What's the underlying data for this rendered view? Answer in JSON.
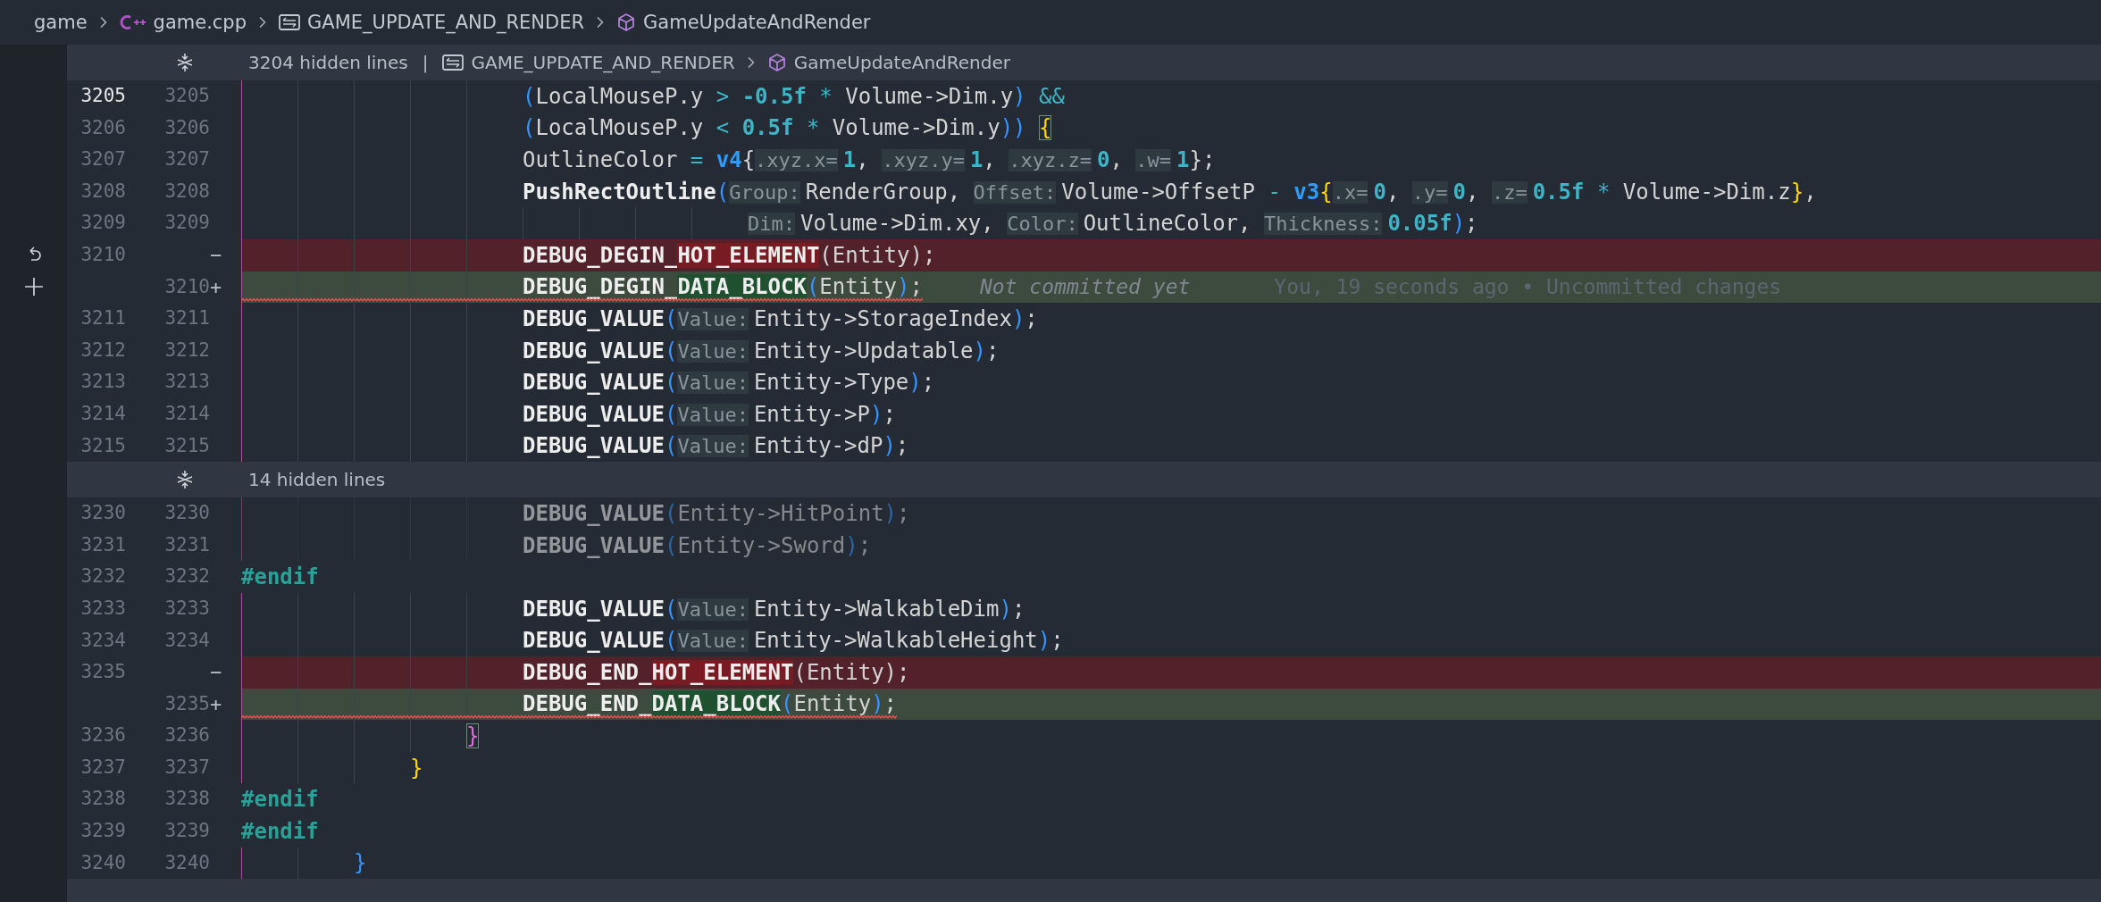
{
  "breadcrumbs": [
    {
      "kind": "folder",
      "text": "game"
    },
    {
      "kind": "cpp",
      "text": "game.cpp"
    },
    {
      "kind": "macro",
      "text": "GAME_UPDATE_AND_RENDER"
    },
    {
      "kind": "function",
      "text": "GameUpdateAndRender"
    }
  ],
  "blocks": [
    {
      "kind": "fold",
      "text": "3204 hidden lines",
      "separator": "|",
      "breadcrumbs": [
        {
          "kind": "macro",
          "text": "GAME_UPDATE_AND_RENDER"
        },
        {
          "kind": "function",
          "text": "GameUpdateAndRender"
        }
      ]
    },
    {
      "kind": "lines",
      "rows": [
        {
          "old": "3205",
          "new": "3205",
          "kind": "context",
          "current": true,
          "indent": "\t\t\t\t\t",
          "tokens": [
            {
              "kind": "paren",
              "text": "("
            },
            {
              "kind": "text",
              "text": "LocalMouseP.y "
            },
            {
              "kind": "op",
              "text": "> "
            },
            {
              "kind": "num",
              "text": "-0.5f "
            },
            {
              "kind": "op",
              "text": "* "
            },
            {
              "kind": "text",
              "text": "Volume->Dim.y"
            },
            {
              "kind": "paren",
              "text": ")"
            },
            {
              "kind": "op",
              "text": " &&"
            }
          ]
        },
        {
          "old": "3206",
          "new": "3206",
          "kind": "context",
          "indent": "\t\t\t\t\t",
          "tokens": [
            {
              "kind": "paren",
              "text": "("
            },
            {
              "kind": "text",
              "text": "LocalMouseP.y "
            },
            {
              "kind": "op",
              "text": "< "
            },
            {
              "kind": "num",
              "text": "0.5f "
            },
            {
              "kind": "op",
              "text": "* "
            },
            {
              "kind": "text",
              "text": "Volume->Dim.y"
            },
            {
              "kind": "paren",
              "text": ")) "
            },
            {
              "kind": "brace",
              "text": "{",
              "color": "#ffd700",
              "matched": true
            }
          ]
        },
        {
          "old": "3207",
          "new": "3207",
          "kind": "context",
          "indent": "\t\t\t\t\t",
          "tokens": [
            {
              "kind": "text",
              "text": "OutlineColor "
            },
            {
              "kind": "op",
              "text": "= "
            },
            {
              "kind": "type",
              "text": "v4"
            },
            {
              "kind": "text",
              "text": "{"
            },
            {
              "kind": "hint",
              "text": ".xyz.x="
            },
            {
              "kind": "num",
              "text": "1"
            },
            {
              "kind": "text",
              "text": ", "
            },
            {
              "kind": "hint",
              "text": ".xyz.y="
            },
            {
              "kind": "num",
              "text": "1"
            },
            {
              "kind": "text",
              "text": ", "
            },
            {
              "kind": "hint",
              "text": ".xyz.z="
            },
            {
              "kind": "num",
              "text": "0"
            },
            {
              "kind": "text",
              "text": ", "
            },
            {
              "kind": "hint",
              "text": ".w="
            },
            {
              "kind": "num",
              "text": "1"
            },
            {
              "kind": "text",
              "text": "};"
            }
          ]
        },
        {
          "old": "3208",
          "new": "3208",
          "kind": "context",
          "indent": "\t\t\t\t\t",
          "tokens": [
            {
              "kind": "fn",
              "text": "PushRectOutline"
            },
            {
              "kind": "paren",
              "text": "("
            },
            {
              "kind": "hint",
              "text": "Group:"
            },
            {
              "kind": "text",
              "text": "RenderGroup, "
            },
            {
              "kind": "hint",
              "text": "Offset:"
            },
            {
              "kind": "text",
              "text": "Volume->OffsetP "
            },
            {
              "kind": "op",
              "text": "- "
            },
            {
              "kind": "type",
              "text": "v3"
            },
            {
              "kind": "brace",
              "text": "{",
              "color": "#ffd700",
              "matched": false
            },
            {
              "kind": "hint",
              "text": ".x="
            },
            {
              "kind": "num",
              "text": "0"
            },
            {
              "kind": "text",
              "text": ", "
            },
            {
              "kind": "hint",
              "text": ".y="
            },
            {
              "kind": "num",
              "text": "0"
            },
            {
              "kind": "text",
              "text": ", "
            },
            {
              "kind": "hint",
              "text": ".z="
            },
            {
              "kind": "num",
              "text": "0.5f "
            },
            {
              "kind": "op",
              "text": "* "
            },
            {
              "kind": "text",
              "text": "Volume->Dim.z"
            },
            {
              "kind": "brace",
              "text": "}",
              "color": "#ffd700",
              "matched": false
            },
            {
              "kind": "text",
              "text": ","
            }
          ]
        },
        {
          "old": "3209",
          "new": "3209",
          "kind": "context",
          "indent": "\t\t\t\t\t\t\t\t\t",
          "tokens": [
            {
              "kind": "hint",
              "text": "Dim:"
            },
            {
              "kind": "text",
              "text": "Volume->Dim.xy, "
            },
            {
              "kind": "hint",
              "text": "Color:"
            },
            {
              "kind": "text",
              "text": "OutlineColor, "
            },
            {
              "kind": "hint",
              "text": "Thickness:"
            },
            {
              "kind": "num",
              "text": "0.05f"
            },
            {
              "kind": "paren",
              "text": ")"
            },
            {
              "kind": "text",
              "text": ";"
            }
          ]
        },
        {
          "old": "3210",
          "marker": "−",
          "kind": "removed",
          "actions": true,
          "indent": "\t\t\t\t\t",
          "tokens": [
            {
              "kind": "fn",
              "text": "DEBUG_DEGIN_"
            },
            {
              "kind": "fn",
              "text": "HOT_ELEMENT",
              "changed": true
            },
            {
              "kind": "text",
              "text": "(Entity);"
            }
          ]
        },
        {
          "new": "3210",
          "marker": "+",
          "kind": "added",
          "actions": true,
          "error": true,
          "indent": "\t\t\t\t\t",
          "tokens": [
            {
              "kind": "fn",
              "text": "DEBUG_DEGIN_"
            },
            {
              "kind": "fn",
              "text": "DATA_BLOCK",
              "changed": true
            },
            {
              "kind": "paren",
              "text": "("
            },
            {
              "kind": "text",
              "text": "Entity"
            },
            {
              "kind": "paren",
              "text": ")"
            },
            {
              "kind": "text",
              "text": ";"
            }
          ],
          "blame": {
            "status": "Not committed yet",
            "details": "You, 19 seconds ago • Uncommitted changes"
          }
        },
        {
          "old": "3211",
          "new": "3211",
          "kind": "context",
          "indent": "\t\t\t\t\t",
          "tokens": [
            {
              "kind": "fn",
              "text": "DEBUG_VALUE"
            },
            {
              "kind": "paren",
              "text": "("
            },
            {
              "kind": "hint",
              "text": "Value:"
            },
            {
              "kind": "text",
              "text": "Entity->StorageIndex"
            },
            {
              "kind": "paren",
              "text": ")"
            },
            {
              "kind": "text",
              "text": ";"
            }
          ]
        },
        {
          "old": "3212",
          "new": "3212",
          "kind": "context",
          "indent": "\t\t\t\t\t",
          "tokens": [
            {
              "kind": "fn",
              "text": "DEBUG_VALUE"
            },
            {
              "kind": "paren",
              "text": "("
            },
            {
              "kind": "hint",
              "text": "Value:"
            },
            {
              "kind": "text",
              "text": "Entity->Updatable"
            },
            {
              "kind": "paren",
              "text": ")"
            },
            {
              "kind": "text",
              "text": ";"
            }
          ]
        },
        {
          "old": "3213",
          "new": "3213",
          "kind": "context",
          "indent": "\t\t\t\t\t",
          "tokens": [
            {
              "kind": "fn",
              "text": "DEBUG_VALUE"
            },
            {
              "kind": "paren",
              "text": "("
            },
            {
              "kind": "hint",
              "text": "Value:"
            },
            {
              "kind": "text",
              "text": "Entity->Type"
            },
            {
              "kind": "paren",
              "text": ")"
            },
            {
              "kind": "text",
              "text": ";"
            }
          ]
        },
        {
          "old": "3214",
          "new": "3214",
          "kind": "context",
          "indent": "\t\t\t\t\t",
          "tokens": [
            {
              "kind": "fn",
              "text": "DEBUG_VALUE"
            },
            {
              "kind": "paren",
              "text": "("
            },
            {
              "kind": "hint",
              "text": "Value:"
            },
            {
              "kind": "text",
              "text": "Entity->P"
            },
            {
              "kind": "paren",
              "text": ")"
            },
            {
              "kind": "text",
              "text": ";"
            }
          ]
        },
        {
          "old": "3215",
          "new": "3215",
          "kind": "context",
          "indent": "\t\t\t\t\t",
          "tokens": [
            {
              "kind": "fn",
              "text": "DEBUG_VALUE"
            },
            {
              "kind": "paren",
              "text": "("
            },
            {
              "kind": "hint",
              "text": "Value:"
            },
            {
              "kind": "text",
              "text": "Entity->dP"
            },
            {
              "kind": "paren",
              "text": ")"
            },
            {
              "kind": "text",
              "text": ";"
            }
          ]
        }
      ]
    },
    {
      "kind": "fold",
      "text": "14 hidden lines"
    },
    {
      "kind": "lines",
      "rows": [
        {
          "old": "3230",
          "new": "3230",
          "kind": "context",
          "inactive": true,
          "indent": "\t\t\t\t\t",
          "tokens": [
            {
              "kind": "fn",
              "text": "DEBUG_VALUE"
            },
            {
              "kind": "paren",
              "text": "("
            },
            {
              "kind": "text",
              "text": "Entity->HitPoint"
            },
            {
              "kind": "paren",
              "text": ")"
            },
            {
              "kind": "text",
              "text": ";"
            }
          ]
        },
        {
          "old": "3231",
          "new": "3231",
          "kind": "context",
          "inactive": true,
          "indent": "\t\t\t\t\t",
          "tokens": [
            {
              "kind": "fn",
              "text": "DEBUG_VALUE"
            },
            {
              "kind": "paren",
              "text": "("
            },
            {
              "kind": "text",
              "text": "Entity->Sword"
            },
            {
              "kind": "paren",
              "text": ")"
            },
            {
              "kind": "text",
              "text": ";"
            }
          ]
        },
        {
          "old": "3232",
          "new": "3232",
          "kind": "context",
          "indent": "",
          "tokens": [
            {
              "kind": "preproc",
              "text": "#endif"
            }
          ]
        },
        {
          "old": "3233",
          "new": "3233",
          "kind": "context",
          "indent": "\t\t\t\t\t",
          "tokens": [
            {
              "kind": "fn",
              "text": "DEBUG_VALUE"
            },
            {
              "kind": "paren",
              "text": "("
            },
            {
              "kind": "hint",
              "text": "Value:"
            },
            {
              "kind": "text",
              "text": "Entity->WalkableDim"
            },
            {
              "kind": "paren",
              "text": ")"
            },
            {
              "kind": "text",
              "text": ";"
            }
          ]
        },
        {
          "old": "3234",
          "new": "3234",
          "kind": "context",
          "indent": "\t\t\t\t\t",
          "tokens": [
            {
              "kind": "fn",
              "text": "DEBUG_VALUE"
            },
            {
              "kind": "paren",
              "text": "("
            },
            {
              "kind": "hint",
              "text": "Value:"
            },
            {
              "kind": "text",
              "text": "Entity->WalkableHeight"
            },
            {
              "kind": "paren",
              "text": ")"
            },
            {
              "kind": "text",
              "text": ";"
            }
          ]
        },
        {
          "old": "3235",
          "marker": "−",
          "kind": "removed",
          "indent": "\t\t\t\t\t",
          "tokens": [
            {
              "kind": "fn",
              "text": "DEBUG_END_"
            },
            {
              "kind": "fn",
              "text": "HOT_ELEMENT",
              "changed": true
            },
            {
              "kind": "text",
              "text": "(Entity);"
            }
          ]
        },
        {
          "new": "3235",
          "marker": "+",
          "kind": "added",
          "error": true,
          "indent": "\t\t\t\t\t",
          "tokens": [
            {
              "kind": "fn",
              "text": "DEBUG_END_"
            },
            {
              "kind": "fn",
              "text": "DATA_BLOCK",
              "changed": true
            },
            {
              "kind": "paren",
              "text": "("
            },
            {
              "kind": "text",
              "text": "Entity"
            },
            {
              "kind": "paren",
              "text": ")"
            },
            {
              "kind": "text",
              "text": ";"
            }
          ]
        },
        {
          "old": "3236",
          "new": "3236",
          "kind": "context",
          "indent": "\t\t\t\t",
          "tokens": [
            {
              "kind": "brace",
              "text": "}",
              "color": "#da70d6",
              "matched": true
            }
          ]
        },
        {
          "old": "3237",
          "new": "3237",
          "kind": "context",
          "indent": "\t\t\t",
          "tokens": [
            {
              "kind": "brace",
              "text": "}",
              "color": "#ffd700",
              "matched": false
            }
          ]
        },
        {
          "old": "3238",
          "new": "3238",
          "kind": "context",
          "indent": "",
          "tokens": [
            {
              "kind": "preproc",
              "text": "#endif"
            }
          ]
        },
        {
          "old": "3239",
          "new": "3239",
          "kind": "context",
          "indent": "",
          "tokens": [
            {
              "kind": "preproc",
              "text": "#endif"
            }
          ]
        },
        {
          "old": "3240",
          "new": "3240",
          "kind": "context",
          "indent": "\t\t",
          "tokens": [
            {
              "kind": "brace",
              "text": "}",
              "color": "#3794ff",
              "matched": false
            }
          ]
        }
      ]
    }
  ]
}
